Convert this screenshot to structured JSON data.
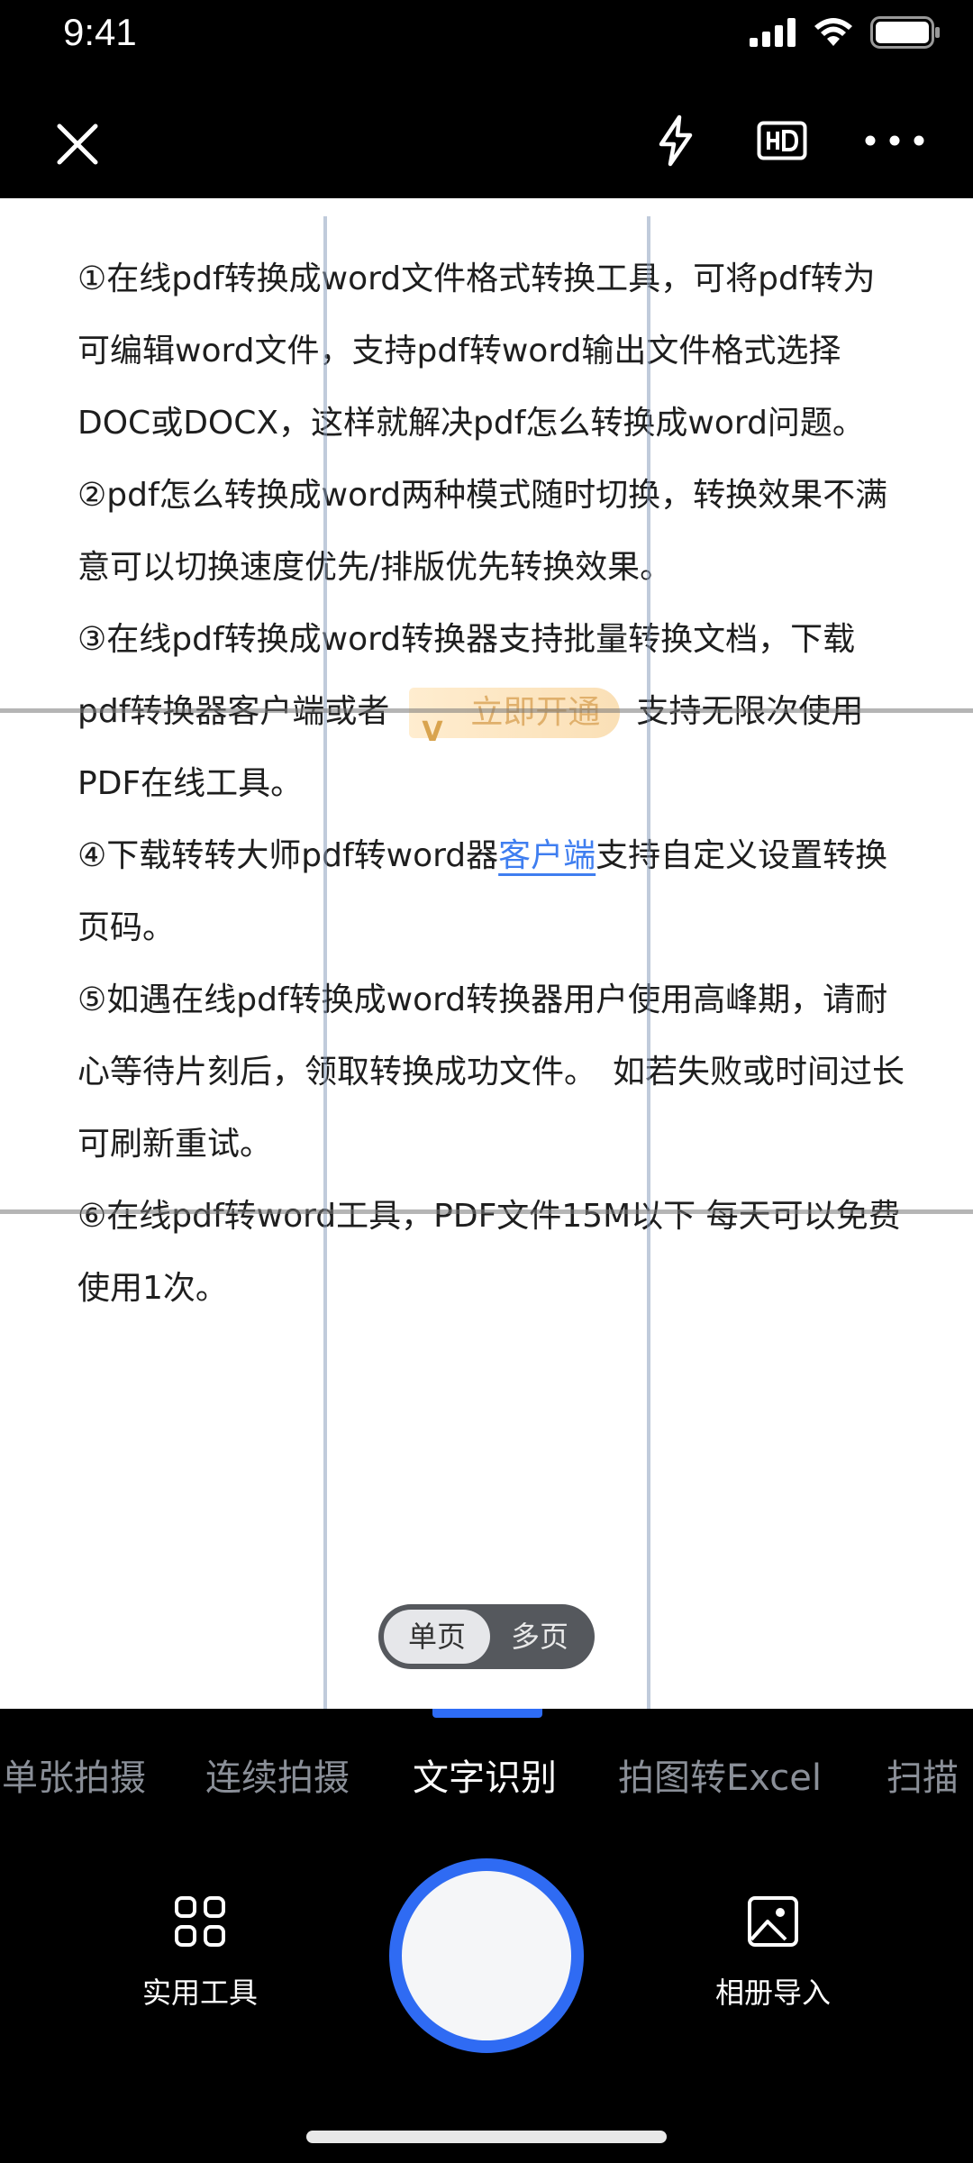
{
  "status_bar": {
    "time": "9:41"
  },
  "document": {
    "paragraphs": [
      "①在线pdf转换成word文件格式转换工具，可将pdf转为可编辑word文件，支持pdf转word输出文件格式选择DOC或DOCX，这样就解决pdf怎么转换成word问题。",
      "②pdf怎么转换成word两种模式随时切换，转换效果不满意可以切换速度优先/排版优先转换效果。"
    ],
    "p3_before": "③在线pdf转换成word转换器支持批量转换文档，下载pdf转换器客户端或者",
    "p3_badge": "立即开通",
    "p3_after": "支持无限次使用PDF在线工具。",
    "p4_before": "④下载转转大师pdf转word器",
    "p4_link": "客户端",
    "p4_after": "支持自定义设置转换页码。",
    "p5": "⑤如遇在线pdf转换成word转换器用户使用高峰期，请耐心等待片刻后，领取转换成功文件。　如若失败或时间过长可刷新重试。",
    "p6": "⑥在线pdf转word工具，PDF文件15M以下 每天可以免费使用1次。"
  },
  "page_toggle": {
    "single": "单页",
    "multi": "多页"
  },
  "mode_tabs": [
    {
      "label": "单张拍摄",
      "active": false
    },
    {
      "label": "连续拍摄",
      "active": false
    },
    {
      "label": "文字识别",
      "active": true
    },
    {
      "label": "拍图转Excel",
      "active": false
    },
    {
      "label": "扫描",
      "active": false
    }
  ],
  "bottom": {
    "tools_label": "实用工具",
    "album_label": "相册导入"
  },
  "colors": {
    "accent": "#2F6BF3",
    "link": "#3F7EF0",
    "background": "#000000"
  }
}
